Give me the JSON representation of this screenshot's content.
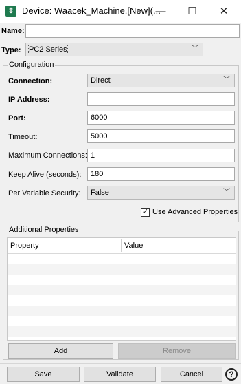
{
  "window": {
    "title": "Device: Waacek_Machine.[New](...",
    "minimize_glyph": "—",
    "maximize_glyph": "☐",
    "close_glyph": "✕"
  },
  "form": {
    "name_label": "Name:",
    "name_value": "",
    "type_label": "Type:",
    "type_value": "PC2 Series"
  },
  "configuration": {
    "title": "Configuration",
    "connection_label": "Connection:",
    "connection_value": "Direct",
    "ip_label": "IP Address:",
    "ip_value": "",
    "port_label": "Port:",
    "port_value": "6000",
    "timeout_label": "Timeout:",
    "timeout_value": "5000",
    "max_conn_label": "Maximum Connections:",
    "max_conn_value": "1",
    "keepalive_label": "Keep Alive (seconds):",
    "keepalive_value": "180",
    "pervar_label": "Per Variable Security:",
    "pervar_value": "False",
    "advanced_label": "Use Advanced Properties",
    "advanced_checked": true
  },
  "additional": {
    "title": "Additional Properties",
    "col_property": "Property",
    "col_value": "Value",
    "add_label": "Add",
    "remove_label": "Remove"
  },
  "footer": {
    "save_label": "Save",
    "validate_label": "Validate",
    "cancel_label": "Cancel",
    "help_glyph": "?"
  }
}
